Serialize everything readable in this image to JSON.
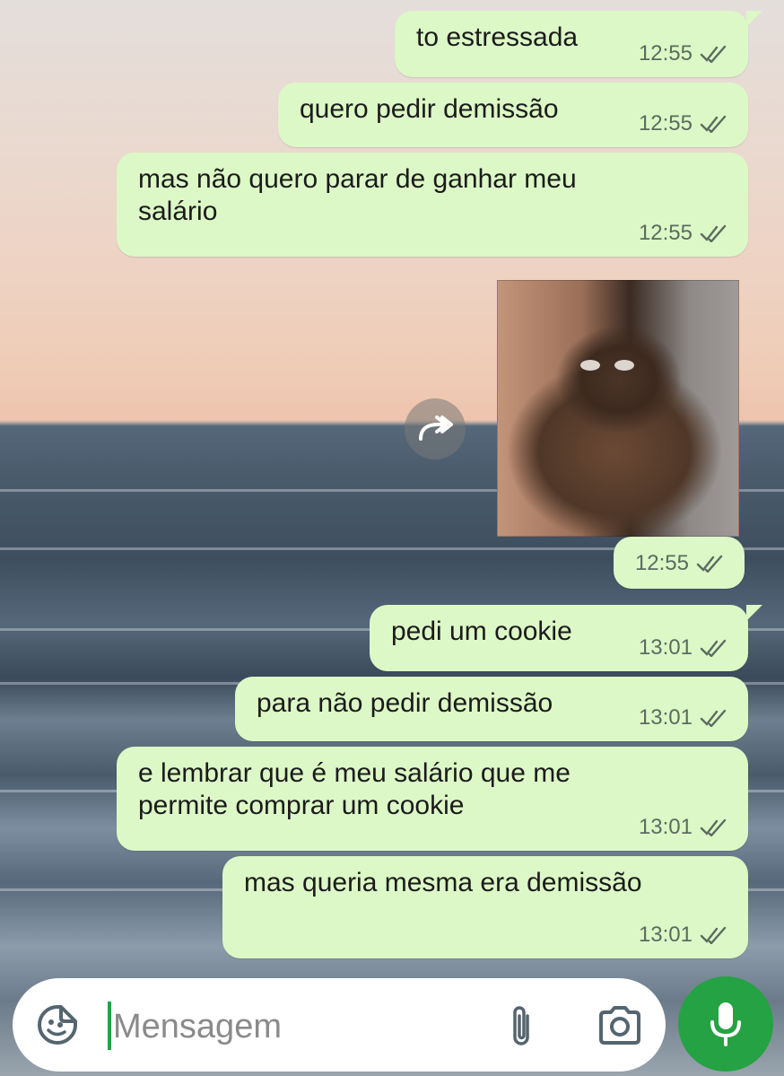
{
  "messages": [
    {
      "text": "to estressada",
      "time": "12:55"
    },
    {
      "text": "quero pedir demissão",
      "time": "12:55"
    },
    {
      "text": "mas não quero parar de ganhar meu salário",
      "time": "12:55"
    },
    {
      "time": "12:55"
    },
    {
      "text": "pedi um cookie",
      "time": "13:01"
    },
    {
      "text": "para não pedir demissão",
      "time": "13:01"
    },
    {
      "text": "e lembrar que é meu salário que me permite comprar um cookie",
      "time": "13:01"
    },
    {
      "text": "mas queria mesma era demissão",
      "time": "13:01"
    }
  ],
  "composer": {
    "placeholder": "Mensagem"
  },
  "colors": {
    "outgoing_bubble": "#dcf8c6",
    "accent": "#25a244"
  },
  "icons": [
    "forward-icon",
    "sticker-icon",
    "attach-icon",
    "camera-icon",
    "mic-icon",
    "double-check-icon"
  ]
}
